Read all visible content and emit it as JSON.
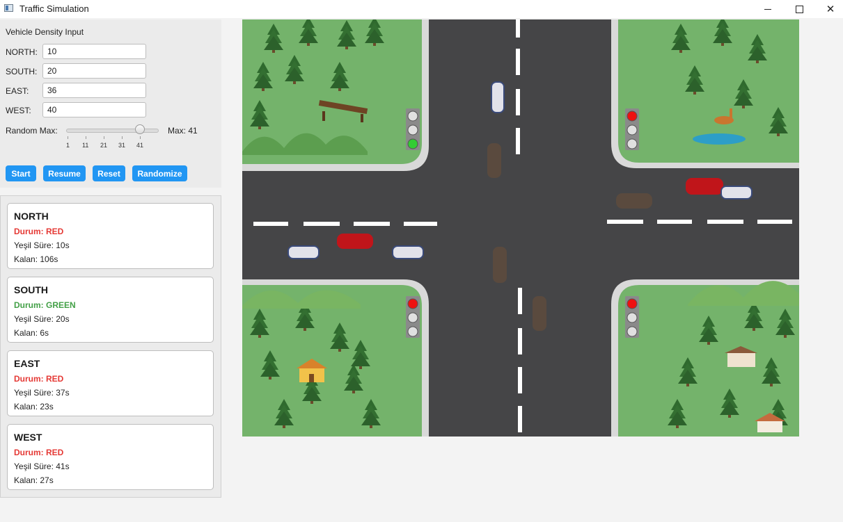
{
  "window": {
    "title": "Traffic Simulation"
  },
  "input_panel": {
    "title": "Vehicle Density Input",
    "fields": [
      {
        "label": "NORTH:",
        "value": "10"
      },
      {
        "label": "SOUTH:",
        "value": "20"
      },
      {
        "label": "EAST:",
        "value": "36"
      },
      {
        "label": "WEST:",
        "value": "40"
      }
    ],
    "random_max": {
      "label": "Random Max:",
      "value": 41,
      "min": 1,
      "ticks": [
        "1",
        "11",
        "21",
        "31",
        "41"
      ],
      "max_label": "Max: 41"
    },
    "buttons": {
      "start": "Start",
      "resume": "Resume",
      "reset": "Reset",
      "randomize": "Randomize"
    }
  },
  "status_cards": [
    {
      "direction": "NORTH",
      "state": "Durum: RED",
      "green_time": "Yeşil Süre: 10s",
      "remaining": "Kalan: 106s"
    },
    {
      "direction": "SOUTH",
      "state": "Durum: GREEN",
      "green_time": "Yeşil Süre: 20s",
      "remaining": "Kalan: 6s"
    },
    {
      "direction": "EAST",
      "state": "Durum: RED",
      "green_time": "Yeşil Süre: 37s",
      "remaining": "Kalan: 23s"
    },
    {
      "direction": "WEST",
      "state": "Durum: RED",
      "green_time": "Yeşil Süre: 41s",
      "remaining": "Kalan: 27s"
    }
  ],
  "colors": {
    "accent": "#2196f3",
    "red": "#e53935",
    "green": "#43a047",
    "grass": "#73b26a",
    "road": "#454547"
  },
  "traffic_lights": {
    "top_left": "green",
    "top_right": "red",
    "bottom_left": "red",
    "bottom_right": "red"
  }
}
